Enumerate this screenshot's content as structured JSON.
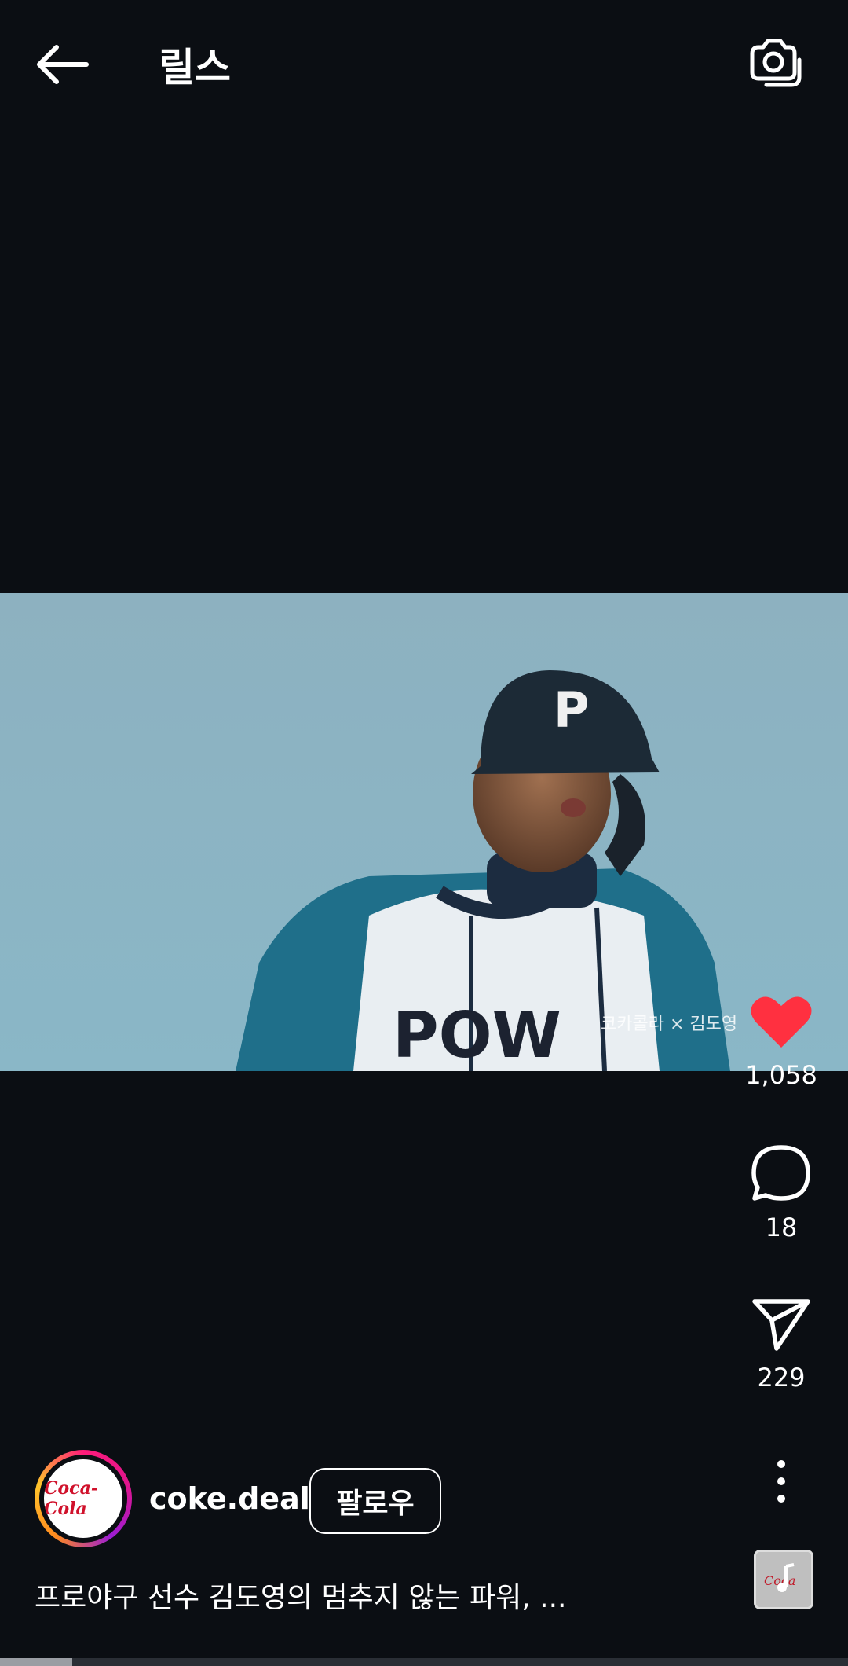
{
  "header": {
    "title": "릴스"
  },
  "icons": {
    "back": "arrow-left-icon",
    "camera": "camera-icon",
    "like": "heart-filled-icon",
    "comment": "comment-bubble-icon",
    "share": "send-icon",
    "more": "vertical-ellipsis-icon",
    "music": "music-note-icon"
  },
  "video": {
    "overlay_text": "코카콜라 × 김도영"
  },
  "actions": {
    "likes": "1,058",
    "comments": "18",
    "shares": "229"
  },
  "author": {
    "username": "coke.deal",
    "avatar_logo_text": "Coca-Cola",
    "follow_label": "팔로우"
  },
  "caption": "프로야구 선수 김도영의 멈추지 않는 파워, ...",
  "progress": {
    "fraction": 0.085
  },
  "colors": {
    "background": "#0b0e13",
    "like_red": "#ff3040",
    "brand_red": "#d0112b"
  }
}
